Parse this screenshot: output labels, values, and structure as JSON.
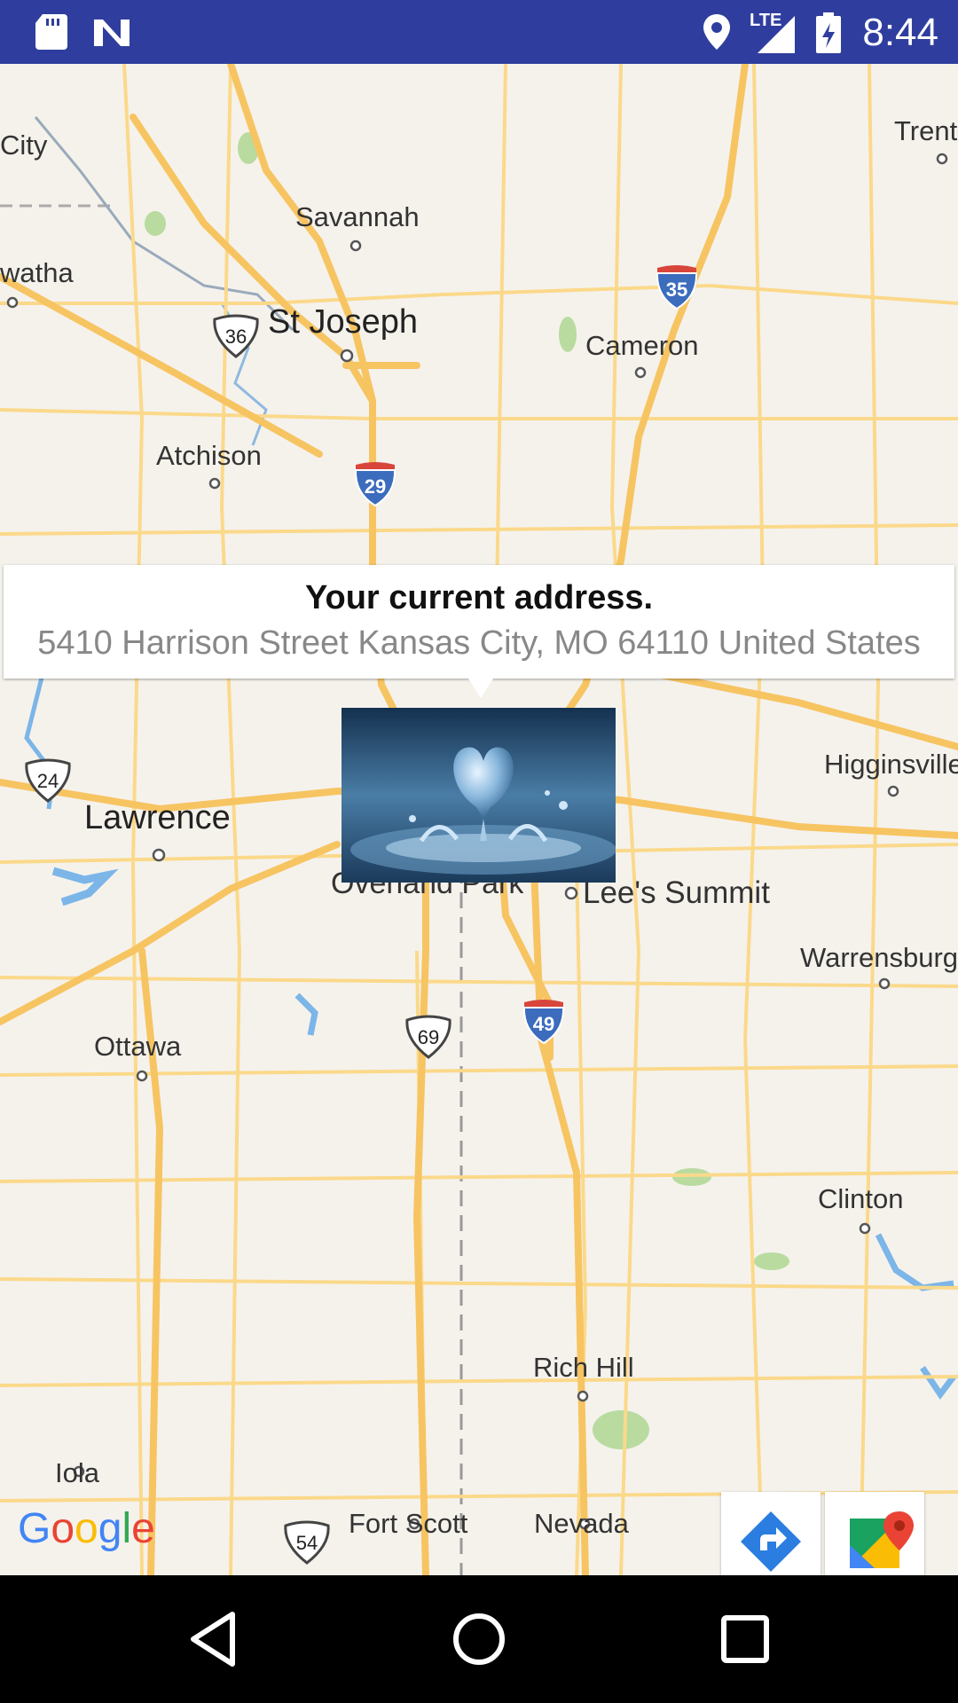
{
  "status_bar": {
    "time": "8:44",
    "network": "LTE",
    "icons": [
      "sd-card-icon",
      "n-notification-icon",
      "location-icon",
      "signal-icon",
      "battery-charging-icon"
    ]
  },
  "map": {
    "places": [
      {
        "id": "city-left",
        "label": "City"
      },
      {
        "id": "trenton",
        "label": "Trent"
      },
      {
        "id": "savannah",
        "label": "Savannah"
      },
      {
        "id": "watha",
        "label": "watha"
      },
      {
        "id": "st-joseph",
        "label": "St Joseph"
      },
      {
        "id": "cameron",
        "label": "Cameron"
      },
      {
        "id": "atchison",
        "label": "Atchison"
      },
      {
        "id": "higginsville",
        "label": "Higginsville"
      },
      {
        "id": "lawrence",
        "label": "Lawrence"
      },
      {
        "id": "overland-park",
        "label": "Overland Park"
      },
      {
        "id": "lees-summit",
        "label": "Lee's Summit"
      },
      {
        "id": "warrensburg",
        "label": "Warrensburg"
      },
      {
        "id": "ottawa",
        "label": "Ottawa"
      },
      {
        "id": "clinton",
        "label": "Clinton"
      },
      {
        "id": "rich-hill",
        "label": "Rich Hill"
      },
      {
        "id": "iola",
        "label": "Iola"
      },
      {
        "id": "fort-scott",
        "label": "Fort Scott"
      },
      {
        "id": "nevada",
        "label": "Nevada"
      }
    ],
    "shields": [
      {
        "id": "us-36",
        "label": "36"
      },
      {
        "id": "i-35",
        "label": "35"
      },
      {
        "id": "i-29",
        "label": "29"
      },
      {
        "id": "us-24",
        "label": "24"
      },
      {
        "id": "us-69",
        "label": "69"
      },
      {
        "id": "i-49",
        "label": "49"
      },
      {
        "id": "us-54",
        "label": "54"
      }
    ],
    "callout": {
      "title": "Your current address.",
      "address": "5410 Harrison Street Kansas City, MO 64110 United States"
    },
    "attribution": "Google"
  },
  "colors": {
    "status_bar": "#2f3e9e",
    "map_land": "#f5f2ec",
    "highway": "#f7c462",
    "road": "#fbd98a",
    "water": "#7cb5e8",
    "park": "#b9dba0"
  }
}
